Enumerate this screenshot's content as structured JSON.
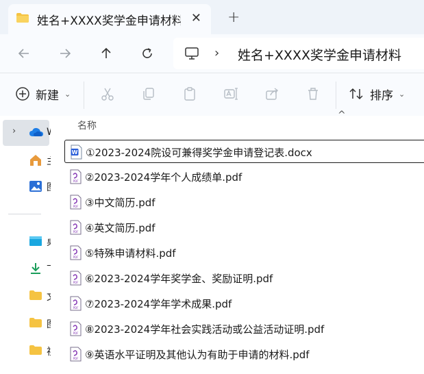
{
  "window": {
    "tab_title": "姓名+XXXX奖学金申请材料",
    "close_glyph": "✕",
    "new_tab_glyph": "+"
  },
  "navigation": {
    "address_path": "姓名+XXXX奖学金申请材料",
    "separator_glyph": "›"
  },
  "command_bar": {
    "new_label": "新建",
    "sort_label": "排序",
    "caret": "⌄"
  },
  "sidebar": {
    "expander_glyph": "›",
    "items": [
      {
        "icon": "cloud-icon",
        "label": "W",
        "selected": true
      },
      {
        "icon": "home-icon",
        "label": "主"
      },
      {
        "icon": "gallery-icon",
        "label": "图"
      },
      {
        "icon": "desktop-icon",
        "label": "桌"
      },
      {
        "icon": "download-icon",
        "label": "下"
      },
      {
        "icon": "folder-icon",
        "label": "文"
      },
      {
        "icon": "folder-icon",
        "label": "图"
      },
      {
        "icon": "folder-icon",
        "label": "视"
      }
    ]
  },
  "file_list": {
    "column_name": "名称",
    "sort_indicator": "^",
    "files": [
      {
        "name": "①2023-2024院设可兼得奖学金申请登记表.docx",
        "type": "docx"
      },
      {
        "name": "②2023-2024学年个人成绩单.pdf",
        "type": "pdf"
      },
      {
        "name": "③中文简历.pdf",
        "type": "pdf"
      },
      {
        "name": "④英文简历.pdf",
        "type": "pdf"
      },
      {
        "name": "⑤特殊申请材料.pdf",
        "type": "pdf"
      },
      {
        "name": "⑥2023-2024学年奖学金、奖励证明.pdf",
        "type": "pdf"
      },
      {
        "name": "⑦2023-2024学年学术成果.pdf",
        "type": "pdf"
      },
      {
        "name": "⑧2023-2024学年社会实践活动或公益活动证明.pdf",
        "type": "pdf"
      },
      {
        "name": "⑨英语水平证明及其他认为有助于申请的材料.pdf",
        "type": "pdf"
      }
    ]
  },
  "colors": {
    "folder": "#f5c342",
    "word": "#2b5fd9",
    "pdf_accent": "#8a3fb7",
    "onedrive": "#1e7ee6"
  }
}
